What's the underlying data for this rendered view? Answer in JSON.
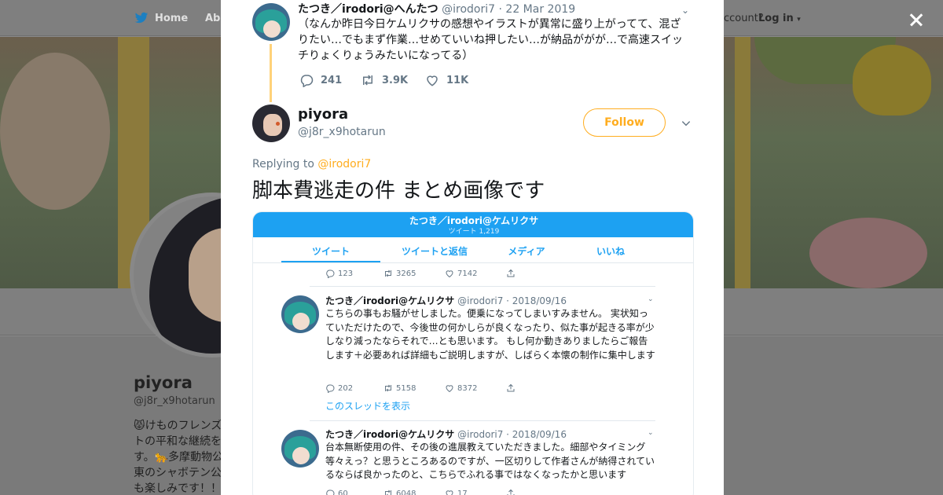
{
  "background": {
    "nav": {
      "home": "Home",
      "about": "Abo",
      "account": "ccount?",
      "login": "Log in"
    },
    "profile": {
      "name": "piyora",
      "handle": "@j8r_x9hotarun",
      "bio": "😾けものフレンズトの平和な継続を す。🐆多摩動物公 東のシャボテン公 も楽しみです！！"
    }
  },
  "parent_tweet": {
    "name": "たつき／irodori@へんたつ",
    "handle": "@irodori7",
    "separator": "·",
    "date": "22 Mar 2019",
    "text": "（なんか昨日今日ケムリクサの感想やイラストが異常に盛り上がってて、混ざりたい…でもまず作業…せめていいね押したい…が納品ががが…で高速スイッチりょくりょうみたいになってる）",
    "replies": "241",
    "retweets": "3.9K",
    "likes": "11K"
  },
  "main_tweet": {
    "name": "piyora",
    "handle": "@j8r_x9hotarun",
    "follow_label": "Follow",
    "replying_to_label": "Replying to",
    "replying_to_handle": "@irodori7",
    "text": "脚本費逃走の件 まとめ画像です"
  },
  "embedded_image": {
    "header_title": "たつき／irodori@ケムリクサ",
    "header_sub": "ツイート 1,219",
    "tabs": [
      "ツイート",
      "ツイートと返信",
      "メディア",
      "いいね"
    ],
    "top_stats": {
      "replies": "123",
      "retweets": "3265",
      "likes": "7142"
    },
    "tweets": [
      {
        "name": "たつき／irodori@ケムリクサ",
        "handle_date": "@irodori7 · 2018/09/16",
        "text": "こちらの事もお騒がせしました。便乗になってしまいすみません。\n実状知っていただけたので、今後世の何かしらが良くなったり、似た事が起きる率が少しなり減ったならそれで…とも思います。\nもし何か動きありましたらご報告します＋必要あれば詳細もご説明しますが、しばらく本懐の制作に集中します",
        "replies": "202",
        "retweets": "5158",
        "likes": "8372",
        "thread_link": "このスレッドを表示"
      },
      {
        "name": "たつき／irodori@ケムリクサ",
        "handle_date": "@irodori7 · 2018/09/16",
        "text": "台本無断使用の件、その後の進展教えていただきました。細部やタイミング等々えっ？と思うところあるのですが、一区切りして作者さんが納得されているならば良かったのと、こちらでふれる事ではなくなったかと思います",
        "replies": "60",
        "retweets": "6048",
        "likes": "17"
      }
    ]
  },
  "colors": {
    "accent": "#ffad1f",
    "twitter_blue": "#1da1f2",
    "muted": "#657786",
    "text": "#14171a"
  },
  "icons": [
    "twitter-bird-icon",
    "close-icon",
    "reply-icon",
    "retweet-icon",
    "like-icon",
    "share-icon",
    "chevron-down-icon"
  ]
}
